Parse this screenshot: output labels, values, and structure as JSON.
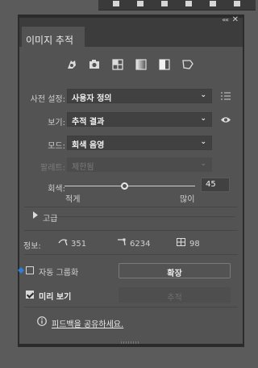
{
  "panel": {
    "tab_title": "이미지 추적",
    "collapse_glyph": "««",
    "close_glyph": "✕"
  },
  "presets_icons": [
    "auto-color-icon",
    "high-color-icon",
    "low-color-icon",
    "grayscale-icon",
    "black-white-icon",
    "outline-icon"
  ],
  "preset": {
    "label": "사전 설정:",
    "value": "사용자 정의"
  },
  "view": {
    "label": "보기:",
    "value": "추적 결과"
  },
  "mode": {
    "label": "모드:",
    "value": "회색 음영"
  },
  "palette": {
    "label": "팔레트:",
    "value": "제한됨"
  },
  "gray": {
    "label": "회색:",
    "value": "45",
    "min_label": "적게",
    "max_label": "많이",
    "level_fraction": 0.46
  },
  "advanced": {
    "label": "고급"
  },
  "info": {
    "label": "정보:",
    "paths": "351",
    "anchors": "6234",
    "colors": "98"
  },
  "autogroup": {
    "label": "자동 그룹화",
    "checked": false,
    "expand_label": "확장"
  },
  "preview": {
    "label": "미리 보기",
    "checked": true,
    "trace_label": "추적"
  },
  "feedback": {
    "label": "피드백을 공유하세요."
  }
}
